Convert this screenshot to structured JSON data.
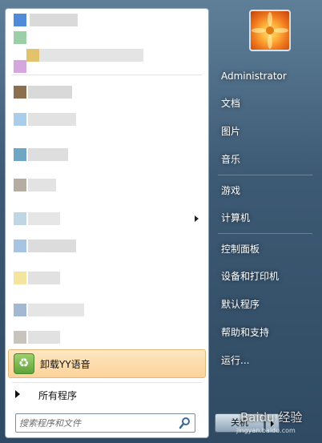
{
  "right_menu": {
    "user": "Administrator",
    "documents": "文档",
    "pictures": "图片",
    "music": "音乐",
    "games": "游戏",
    "computer": "计算机",
    "control_panel": "控制面板",
    "devices_printers": "设备和打印机",
    "default_programs": "默认程序",
    "help_support": "帮助和支持",
    "run": "运行..."
  },
  "left_menu": {
    "highlighted_item": "卸载YY语音",
    "all_programs": "所有程序",
    "search_placeholder": "搜索程序和文件"
  },
  "shutdown_label": "关机",
  "watermark": {
    "main": "Baidu 经验",
    "sub": "jingyan.baidu.com"
  },
  "icons": {
    "yy_uninstall": "recycle-icon",
    "search": "search-icon",
    "avatar": "flower-avatar"
  },
  "colors": {
    "highlight": "#fbd39a",
    "right_panel": "#3d5a74"
  }
}
